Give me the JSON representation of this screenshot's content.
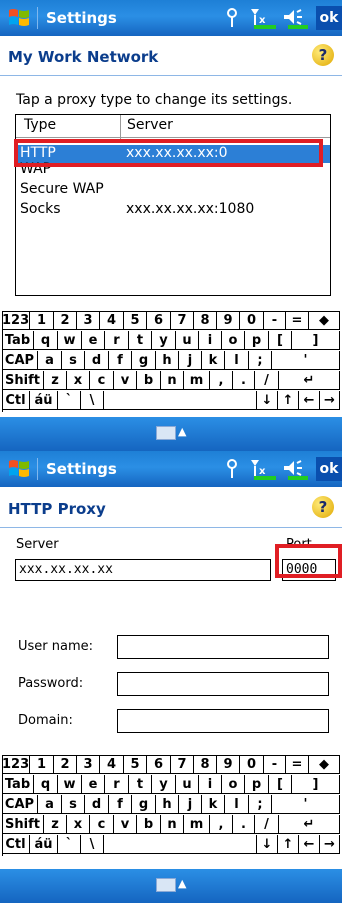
{
  "screen1": {
    "title": "Settings",
    "ok_label": "ok",
    "heading": "My Work Network",
    "help_label": "?",
    "instruction": "Tap a proxy type to change its settings.",
    "columns": [
      "Type",
      "Server"
    ],
    "rows": [
      {
        "type": "HTTP",
        "server": "xxx.xx.xx.xx:0",
        "selected": true
      },
      {
        "type": "WAP",
        "server": ""
      },
      {
        "type": "Secure WAP",
        "server": ""
      },
      {
        "type": "Socks",
        "server": "xxx.xx.xx.xx:1080"
      }
    ]
  },
  "screen2": {
    "title": "Settings",
    "ok_label": "ok",
    "heading": "HTTP Proxy",
    "help_label": "?",
    "server_label": "Server",
    "server_value": "xxx.xx.xx.xx",
    "port_label": "Port",
    "port_value": "0000",
    "username_label": "User name:",
    "password_label": "Password:",
    "domain_label": "Domain:"
  },
  "keyboard": {
    "row1": [
      "123",
      "1",
      "2",
      "3",
      "4",
      "5",
      "6",
      "7",
      "8",
      "9",
      "0",
      "-",
      "=",
      "◆"
    ],
    "row2": [
      "Tab",
      "q",
      "w",
      "e",
      "r",
      "t",
      "y",
      "u",
      "i",
      "o",
      "p",
      "[",
      "]"
    ],
    "row3": [
      "CAP",
      "a",
      "s",
      "d",
      "f",
      "g",
      "h",
      "j",
      "k",
      "l",
      ";",
      "'"
    ],
    "row4": [
      "Shift",
      "z",
      "x",
      "c",
      "v",
      "b",
      "n",
      "m",
      ",",
      ".",
      "/",
      "↵"
    ],
    "row5": [
      "Ctl",
      "áü",
      "`",
      "\\",
      "",
      "↓",
      "↑",
      "←",
      "→"
    ]
  },
  "colors": {
    "title_bar": "#1e7fd6",
    "selection": "#2c7fd6",
    "highlight": "#e01e24",
    "heading": "#0b3d8c"
  }
}
